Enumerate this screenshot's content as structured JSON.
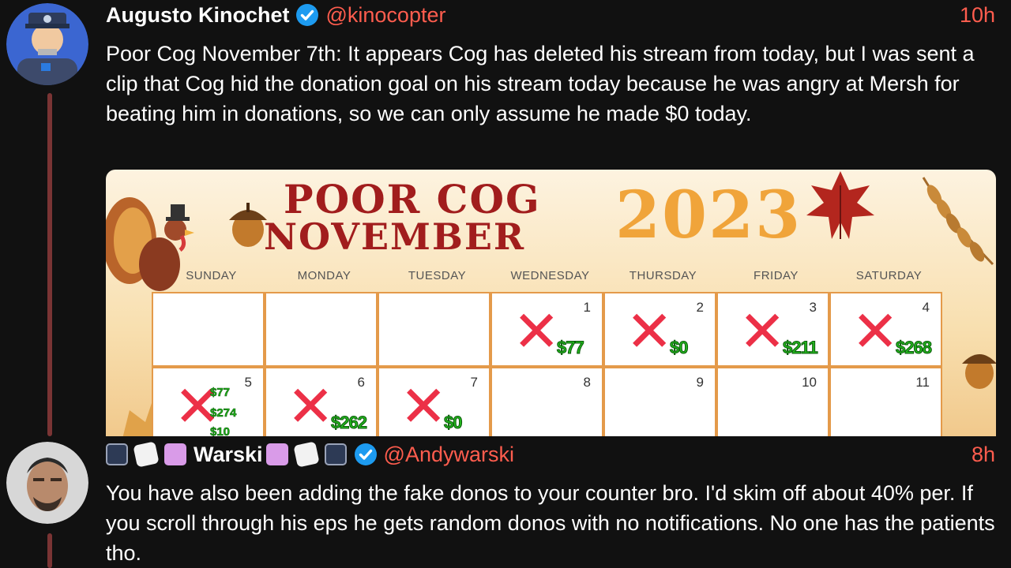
{
  "post1": {
    "author_name": "Augusto Kinochet",
    "handle": "@kinocopter",
    "time": "10h",
    "text": "Poor Cog November 7th: It appears Cog has deleted his stream from today, but I was sent a clip that Cog hid the donation goal on his stream today because he was angry at Mersh for beating him in donations, so we can only assume he made $0 today.",
    "image": {
      "title_line1": "POOR COG",
      "title_line2": "NOVEMBER",
      "year": "2023",
      "days": [
        "SUNDAY",
        "MONDAY",
        "TUESDAY",
        "WEDNESDAY",
        "THURSDAY",
        "FRIDAY",
        "SATURDAY"
      ],
      "week1": [
        {
          "num": "",
          "x": false,
          "amount": ""
        },
        {
          "num": "",
          "x": false,
          "amount": ""
        },
        {
          "num": "",
          "x": false,
          "amount": ""
        },
        {
          "num": "1",
          "x": true,
          "amount": "$77"
        },
        {
          "num": "2",
          "x": true,
          "amount": "$0"
        },
        {
          "num": "3",
          "x": true,
          "amount": "$211"
        },
        {
          "num": "4",
          "x": true,
          "amount": "$268"
        }
      ],
      "week2": [
        {
          "num": "5",
          "x": true,
          "amounts": [
            "$77",
            "$274",
            "$10"
          ]
        },
        {
          "num": "6",
          "x": true,
          "amount": "$262"
        },
        {
          "num": "7",
          "x": true,
          "amount": "$0"
        },
        {
          "num": "8",
          "x": false,
          "amount": ""
        },
        {
          "num": "9",
          "x": false,
          "amount": ""
        },
        {
          "num": "10",
          "x": false,
          "amount": ""
        },
        {
          "num": "11",
          "x": false,
          "amount": ""
        }
      ],
      "x_mark": "✕"
    }
  },
  "post2": {
    "author_name": "Warski",
    "handle": "@Andywarski",
    "time": "8h",
    "text": "You have also been adding the fake donos to your counter bro. I'd skim off about 40% per. If you scroll through his eps he gets random donos with no notifications. No one has the patients tho."
  },
  "colors": {
    "background": "#111111",
    "accent": "#ff5d4e",
    "thread_line": "#7a3434",
    "verified": "#1d9bf0"
  }
}
